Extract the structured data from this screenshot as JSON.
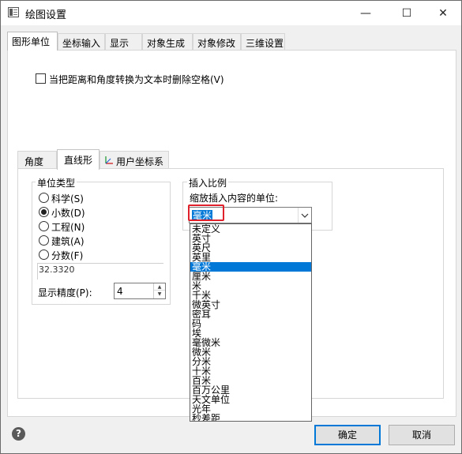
{
  "window": {
    "title": "绘图设置",
    "minimize_glyph": "—",
    "maximize_glyph": "☐",
    "close_glyph": "✕"
  },
  "tabs": [
    {
      "label": "图形单位",
      "active": true
    },
    {
      "label": "坐标输入",
      "active": false
    },
    {
      "label": "显示",
      "active": false
    },
    {
      "label": "对象生成",
      "active": false
    },
    {
      "label": "对象修改",
      "active": false
    },
    {
      "label": "三维设置",
      "active": false
    }
  ],
  "remove_spaces_checkbox": {
    "label": "当把距离和角度转换为文本时删除空格(V)",
    "checked": false
  },
  "inner_tabs": [
    {
      "label": "角度",
      "active": false
    },
    {
      "label": "直线形",
      "active": true
    },
    {
      "label": "用户坐标系",
      "active": false,
      "icon": "ucs-axis-icon"
    }
  ],
  "unit_type": {
    "title": "单位类型",
    "options": [
      {
        "label": "科学(S)",
        "checked": false
      },
      {
        "label": "小数(D)",
        "checked": true
      },
      {
        "label": "工程(N)",
        "checked": false
      },
      {
        "label": "建筑(A)",
        "checked": false
      },
      {
        "label": "分数(F)",
        "checked": false
      }
    ],
    "preview_value": "32.3320",
    "precision_label": "显示精度(P):",
    "precision_value": "4"
  },
  "insert_scale": {
    "title": "插入比例",
    "units_label": "缩放插入内容的单位:",
    "selected_value": "毫米",
    "options": [
      "未定义",
      "英寸",
      "英尺",
      "英里",
      "毫米",
      "厘米",
      "米",
      "千米",
      "微英寸",
      "密耳",
      "码",
      "埃",
      "毫微米",
      "微米",
      "分米",
      "十米",
      "百米",
      "百万公里",
      "天文单位",
      "光年",
      "秒差距"
    ],
    "highlighted_index": 4
  },
  "buttons": {
    "ok": "确定",
    "cancel": "取消",
    "help": "?"
  },
  "colors": {
    "accent": "#0078d7",
    "highlight_box": "#e0202a"
  }
}
